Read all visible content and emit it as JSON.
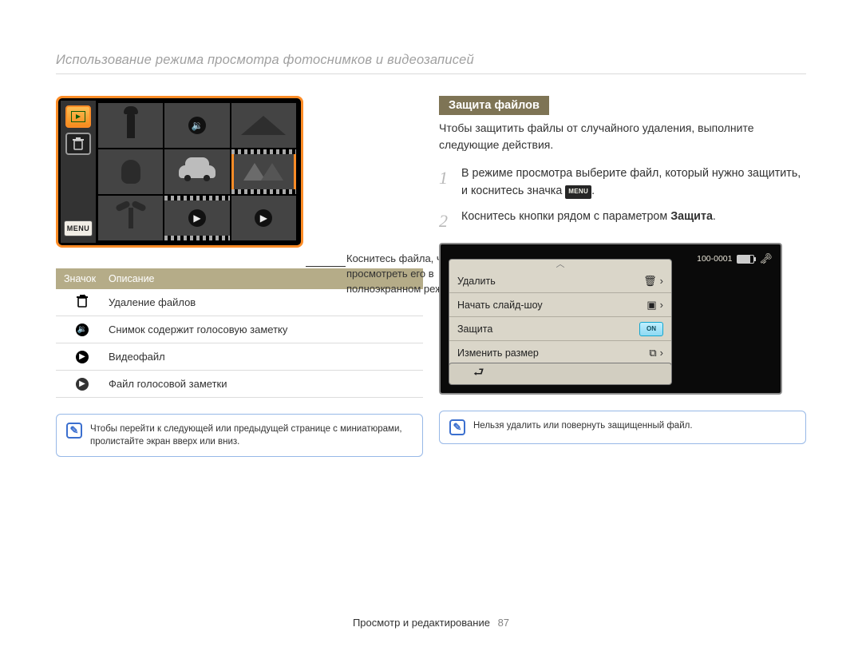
{
  "page_title": "Использование режима просмотра фотоснимков и видеозаписей",
  "camera_grid": {
    "sidebar_menu_label": "MENU",
    "callout": "Коснитесь файла, чтобы просмотреть его в полноэкранном режиме."
  },
  "icon_table": {
    "head_icon": "Значок",
    "head_desc": "Описание",
    "rows": [
      {
        "icon": "del",
        "desc": "Удаление файлов"
      },
      {
        "icon": "voice",
        "desc": "Снимок содержит голосовую заметку"
      },
      {
        "icon": "video",
        "desc": "Видеофайл"
      },
      {
        "icon": "memo",
        "desc": "Файл голосовой заметки"
      }
    ]
  },
  "note_left": "Чтобы перейти к следующей или предыдущей странице с миниатюрами, пролистайте экран вверх или вниз.",
  "section_heading": "Защита файлов",
  "intro": "Чтобы защитить файлы от случайного удаления, выполните следующие действия.",
  "steps": [
    {
      "num": "1",
      "text_a": "В режиме просмотра выберите файл, который нужно защитить, и коснитесь значка ",
      "pill": "MENU",
      "text_b": "."
    },
    {
      "num": "2",
      "text_a": "Коснитесь кнопки рядом с параметром ",
      "bold": "Защита",
      "text_b": "."
    }
  ],
  "menu_panel": {
    "file_counter": "100-0001",
    "rows": [
      {
        "label": "Удалить",
        "ctrl": "trash"
      },
      {
        "label": "Начать слайд-шоу",
        "ctrl": "slide"
      },
      {
        "label": "Защита",
        "ctrl": "toggle",
        "toggle_text": "ON"
      },
      {
        "label": "Изменить размер",
        "ctrl": "resize"
      }
    ]
  },
  "note_right": "Нельзя удалить или повернуть защищенный файл.",
  "footer_section": "Просмотр и редактирование",
  "footer_page": "87"
}
